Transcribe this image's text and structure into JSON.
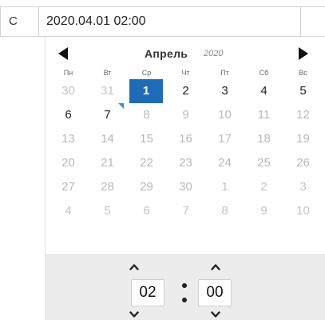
{
  "field": {
    "label": "С",
    "value": "2020.04.01 02:00"
  },
  "calendar": {
    "month": "Апрель",
    "year": "2020",
    "weekdays": [
      "Пн",
      "Вт",
      "Ср",
      "Чт",
      "Пт",
      "Сб",
      "Вс"
    ],
    "weeks": [
      [
        {
          "d": "30",
          "s": "muted"
        },
        {
          "d": "31",
          "s": "muted"
        },
        {
          "d": "1",
          "s": "sel"
        },
        {
          "d": "2",
          "s": ""
        },
        {
          "d": "3",
          "s": ""
        },
        {
          "d": "4",
          "s": ""
        },
        {
          "d": "5",
          "s": ""
        }
      ],
      [
        {
          "d": "6",
          "s": ""
        },
        {
          "d": "7",
          "s": "today"
        },
        {
          "d": "8",
          "s": "dim"
        },
        {
          "d": "9",
          "s": "dim"
        },
        {
          "d": "10",
          "s": "dim"
        },
        {
          "d": "11",
          "s": "dim"
        },
        {
          "d": "12",
          "s": "dim"
        }
      ],
      [
        {
          "d": "13",
          "s": "dim"
        },
        {
          "d": "14",
          "s": "dim"
        },
        {
          "d": "15",
          "s": "dim"
        },
        {
          "d": "16",
          "s": "dim"
        },
        {
          "d": "17",
          "s": "dim"
        },
        {
          "d": "18",
          "s": "dim"
        },
        {
          "d": "19",
          "s": "dim"
        }
      ],
      [
        {
          "d": "20",
          "s": "dim"
        },
        {
          "d": "21",
          "s": "dim"
        },
        {
          "d": "22",
          "s": "dim"
        },
        {
          "d": "23",
          "s": "dim"
        },
        {
          "d": "24",
          "s": "dim"
        },
        {
          "d": "25",
          "s": "dim"
        },
        {
          "d": "26",
          "s": "dim"
        }
      ],
      [
        {
          "d": "27",
          "s": "dim"
        },
        {
          "d": "28",
          "s": "dim"
        },
        {
          "d": "29",
          "s": "dim"
        },
        {
          "d": "30",
          "s": "dim"
        },
        {
          "d": "1",
          "s": "muted"
        },
        {
          "d": "2",
          "s": "muted"
        },
        {
          "d": "3",
          "s": "muted"
        }
      ],
      [
        {
          "d": "4",
          "s": "muted"
        },
        {
          "d": "5",
          "s": "muted"
        },
        {
          "d": "6",
          "s": "muted"
        },
        {
          "d": "7",
          "s": "muted"
        },
        {
          "d": "8",
          "s": "muted"
        },
        {
          "d": "9",
          "s": "muted"
        },
        {
          "d": "10",
          "s": "muted"
        }
      ]
    ],
    "selected_color": "#1f6bb7",
    "today_marker_color": "#2f8fe0"
  },
  "time": {
    "hours": "02",
    "minutes": "00",
    "panel_color": "#ececec"
  },
  "icons": {
    "prev": "triangle-left-icon",
    "next": "triangle-right-icon",
    "up": "chevron-up-icon",
    "down": "chevron-down-icon"
  }
}
